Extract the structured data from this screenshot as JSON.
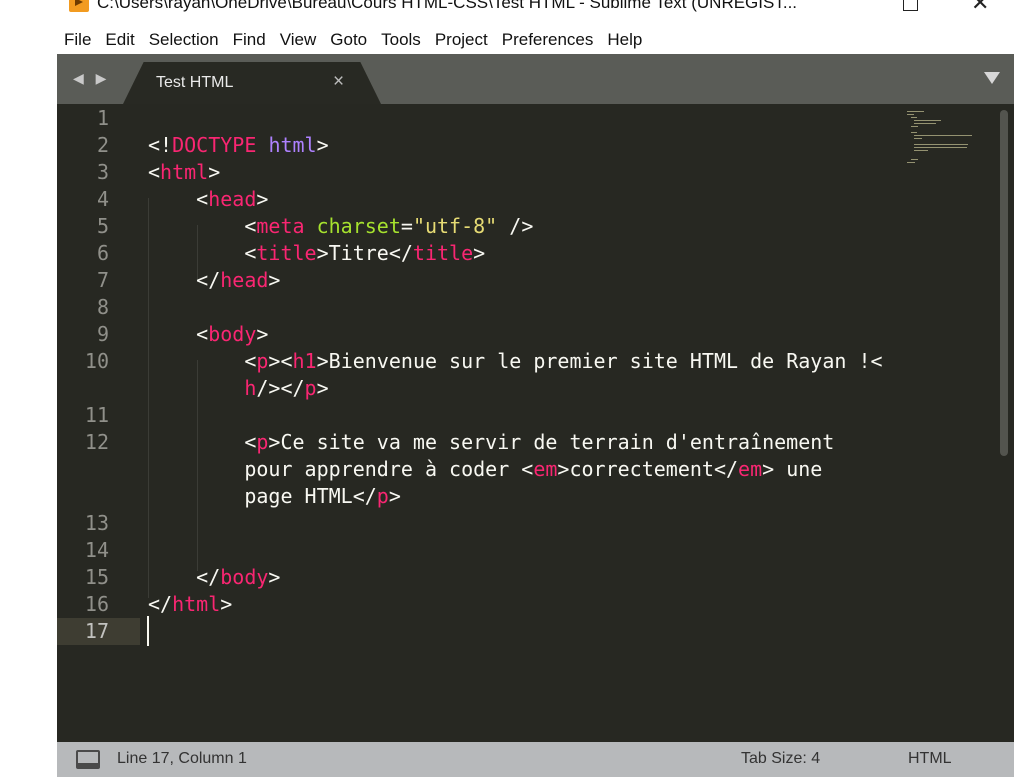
{
  "window": {
    "title": "C:\\Users\\rayan\\OneDrive\\Bureau\\Cours HTML-CSS\\Test HTML - Sublime Text (UNREGIST...",
    "minimize": "—",
    "close": "✕"
  },
  "menu": [
    "File",
    "Edit",
    "Selection",
    "Find",
    "View",
    "Goto",
    "Tools",
    "Project",
    "Preferences",
    "Help"
  ],
  "tabs": {
    "nav": "◀ ▶",
    "active": "Test HTML",
    "close": "×"
  },
  "gutter": [
    "1",
    "2",
    "3",
    "4",
    "5",
    "6",
    "7",
    "8",
    "9",
    "10",
    "",
    "11",
    "12",
    "",
    "",
    "13",
    "14",
    "15",
    "16",
    "17"
  ],
  "code": [
    [],
    [
      [
        "",
        "<!"
      ],
      [
        "t",
        "DOCTYPE"
      ],
      [
        "",
        " "
      ],
      [
        "k",
        "html"
      ],
      [
        "",
        ">"
      ]
    ],
    [
      [
        "",
        "<"
      ],
      [
        "t",
        "html"
      ],
      [
        "",
        ">"
      ]
    ],
    [
      [
        "",
        "    <"
      ],
      [
        "t",
        "head"
      ],
      [
        "",
        ">"
      ]
    ],
    [
      [
        "",
        "        <"
      ],
      [
        "t",
        "meta"
      ],
      [
        "",
        " "
      ],
      [
        "a",
        "charset"
      ],
      [
        "",
        "="
      ],
      [
        "s",
        "\"utf-8\""
      ],
      [
        "",
        " />"
      ]
    ],
    [
      [
        "",
        "        <"
      ],
      [
        "t",
        "title"
      ],
      [
        "",
        ">Titre</"
      ],
      [
        "t",
        "title"
      ],
      [
        "",
        ">"
      ]
    ],
    [
      [
        "",
        "    </"
      ],
      [
        "t",
        "head"
      ],
      [
        "",
        ">"
      ]
    ],
    [],
    [
      [
        "",
        "    <"
      ],
      [
        "t",
        "body"
      ],
      [
        "",
        ">"
      ]
    ],
    [
      [
        "",
        "        <"
      ],
      [
        "t",
        "p"
      ],
      [
        "",
        "><"
      ],
      [
        "t",
        "h1"
      ],
      [
        "",
        ">Bienvenue sur le premier site HTML de Rayan !<"
      ]
    ],
    [
      [
        "",
        "        "
      ],
      [
        "t",
        "h"
      ],
      [
        "",
        "/></"
      ],
      [
        "t",
        "p"
      ],
      [
        "",
        ">"
      ]
    ],
    [],
    [
      [
        "",
        "        <"
      ],
      [
        "t",
        "p"
      ],
      [
        "",
        ">Ce site va me servir de terrain d'entraînement"
      ]
    ],
    [
      [
        "",
        "        pour apprendre à coder <"
      ],
      [
        "t",
        "em"
      ],
      [
        "",
        ">correctement</"
      ],
      [
        "t",
        "em"
      ],
      [
        "",
        "> une"
      ]
    ],
    [
      [
        "",
        "        page HTML</"
      ],
      [
        "t",
        "p"
      ],
      [
        "",
        ">"
      ]
    ],
    [],
    [],
    [
      [
        "",
        "    </"
      ],
      [
        "t",
        "body"
      ],
      [
        "",
        ">"
      ]
    ],
    [
      [
        "",
        "</"
      ],
      [
        "t",
        "html"
      ],
      [
        "",
        ">"
      ]
    ],
    []
  ],
  "status": {
    "position": "Line 17, Column 1",
    "tab_size": "Tab Size: 4",
    "syntax": "HTML"
  }
}
